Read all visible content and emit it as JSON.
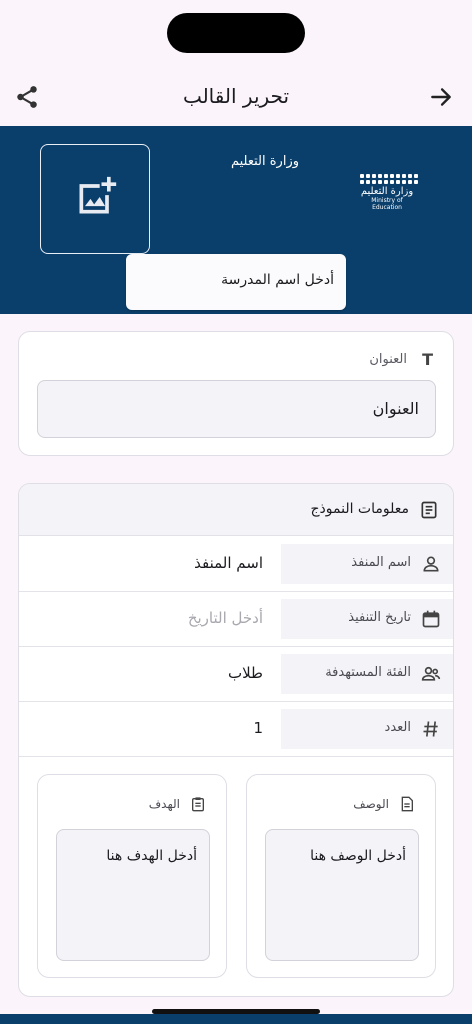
{
  "header": {
    "title": "تحرير القالب",
    "share_icon": "share-icon",
    "back_icon": "arrow-right-icon"
  },
  "banner": {
    "ministry_text": "وزارة التعليم",
    "logo_ar": "وزارة التعليم",
    "logo_en": "Ministry of Education",
    "school_name_placeholder": "أدخل اسم المدرسة",
    "add_image_icon": "add-photo-icon",
    "color": "#0b3f6b"
  },
  "title_section": {
    "label": "العنوان",
    "value": "العنوان"
  },
  "form_info": {
    "heading": "معلومات النموذج",
    "rows": [
      {
        "label": "اسم المنفذ",
        "value": "اسم المنفذ",
        "icon": "person-icon"
      },
      {
        "label": "تاريخ التنفيذ",
        "value": "أدخل التاريخ",
        "icon": "calendar-icon"
      },
      {
        "label": "الفئة المستهدفة",
        "value": "طلاب",
        "icon": "group-icon"
      },
      {
        "label": "العدد",
        "value": "1",
        "icon": "hash-icon"
      }
    ],
    "description": {
      "label": "الوصف",
      "placeholder": "أدخل الوصف هنا"
    },
    "goal": {
      "label": "الهدف",
      "placeholder": "أدخل الهدف هنا"
    }
  }
}
